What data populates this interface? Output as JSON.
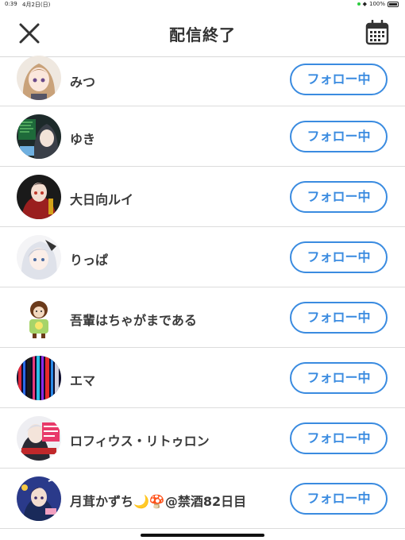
{
  "status_bar": {
    "time": "0:39",
    "date": "4月2日(日)",
    "battery": "100%"
  },
  "header": {
    "title": "配信終了",
    "close_icon": "close-icon",
    "calendar_icon": "calendar-icon"
  },
  "follow_label": "フォロー中",
  "users": [
    {
      "name": "みつ"
    },
    {
      "name": "ゆき"
    },
    {
      "name": "大日向ルイ"
    },
    {
      "name": "りっぱ"
    },
    {
      "name": "吾輩はちゃがまである"
    },
    {
      "name": "エマ"
    },
    {
      "name": "ロフィウス・リトゥロン"
    },
    {
      "name": "月茸かずち🌙🍄@禁酒82日目"
    }
  ],
  "colors": {
    "accent": "#3a8be0",
    "text": "#333333",
    "divider": "#dcdcdc"
  }
}
